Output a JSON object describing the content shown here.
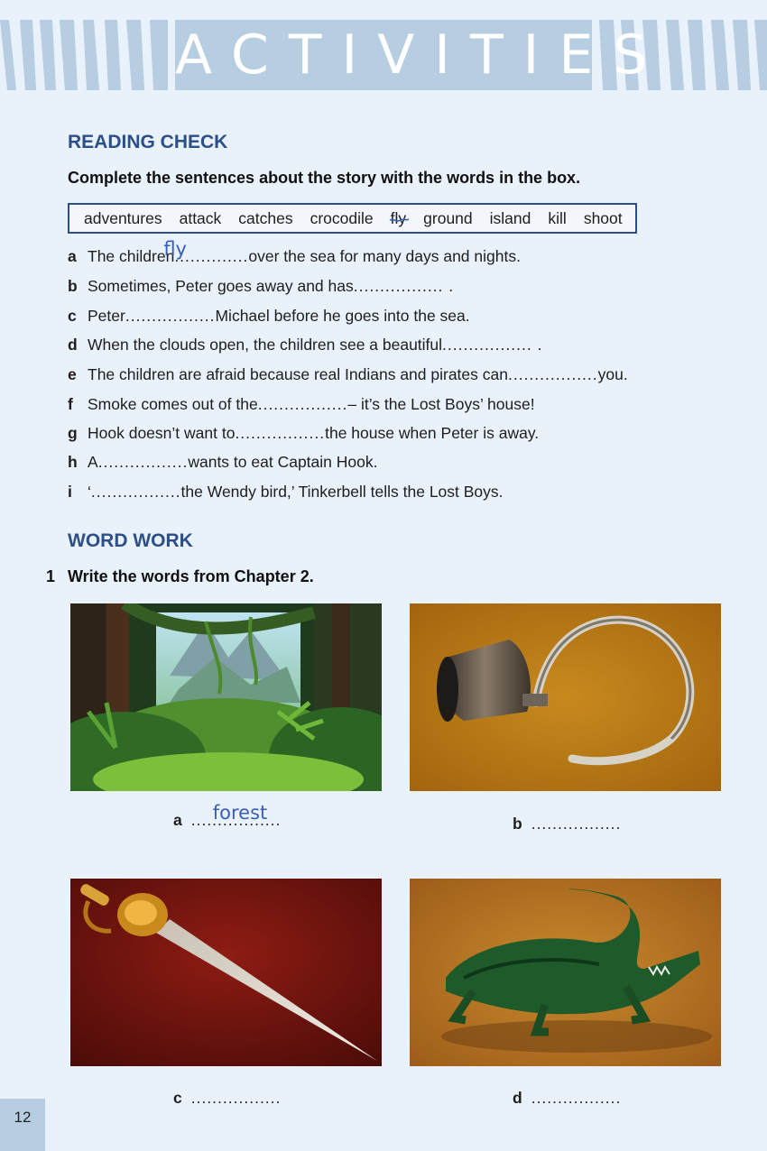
{
  "header": {
    "title": "ACTIVITIES"
  },
  "reading_check": {
    "heading": "READING CHECK",
    "instruction": "Complete the sentences about the story with the words in the box.",
    "words": [
      "adventures",
      "attack",
      "catches",
      "crocodile",
      "fly",
      "ground",
      "island",
      "kill",
      "shoot"
    ],
    "sentences": [
      {
        "letter": "a",
        "before": "The children",
        "dots1": "........",
        "answer": "fly",
        "dots2": "......",
        "after": "over the sea for many days and nights."
      },
      {
        "letter": "b",
        "before": "Sometimes, Peter goes away and has",
        "dots1": "................. .",
        "answer": "",
        "dots2": "",
        "after": ""
      },
      {
        "letter": "c",
        "before": "Peter",
        "dots1": ".................",
        "answer": "",
        "dots2": "",
        "after": "Michael before he goes into the sea."
      },
      {
        "letter": "d",
        "before": "When the clouds open, the children see a beautiful",
        "dots1": "................. .",
        "answer": "",
        "dots2": "",
        "after": ""
      },
      {
        "letter": "e",
        "before": "The children are afraid because real Indians and pirates can",
        "dots1": ".................",
        "answer": "",
        "dots2": "",
        "after": "you."
      },
      {
        "letter": "f",
        "before": "Smoke comes out of the",
        "dots1": ".................",
        "answer": "",
        "dots2": "",
        "after": "– it’s the Lost Boys’ house!"
      },
      {
        "letter": "g",
        "before": "Hook doesn’t want to",
        "dots1": ".................",
        "answer": "",
        "dots2": "",
        "after": "the house when Peter is away."
      },
      {
        "letter": "h",
        "before": "A",
        "dots1": ".................",
        "answer": "",
        "dots2": "",
        "after": "wants to eat Captain Hook."
      },
      {
        "letter": "i",
        "before": "‘",
        "dots1": ".................",
        "answer": "",
        "dots2": "",
        "after": "the Wendy bird,’ Tinkerbell tells the Lost Boys."
      }
    ]
  },
  "word_work": {
    "heading": "WORD WORK",
    "number": "1",
    "instruction": "Write the words from Chapter 2.",
    "items": [
      {
        "letter": "a",
        "dots": ".................",
        "answer": "forest",
        "picture": "jungle-forest"
      },
      {
        "letter": "b",
        "dots": ".................",
        "answer": "",
        "picture": "hook"
      },
      {
        "letter": "c",
        "dots": ".................",
        "answer": "",
        "picture": "sword"
      },
      {
        "letter": "d",
        "dots": ".................",
        "answer": "",
        "picture": "crocodile"
      }
    ]
  },
  "page_number": "12",
  "colors": {
    "heading": "#2d4f88",
    "banner": "#b6cde2",
    "handwriting": "#3a5fb6",
    "background": "#e9f1fa"
  }
}
